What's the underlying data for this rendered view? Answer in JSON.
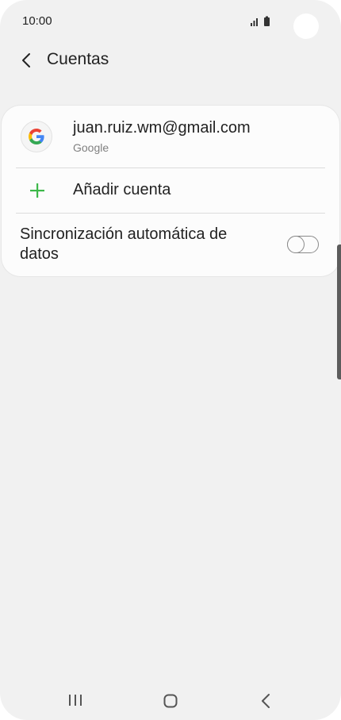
{
  "status_bar": {
    "time": "10:00"
  },
  "header": {
    "title": "Cuentas"
  },
  "accounts": [
    {
      "email": "juan.ruiz.wm@gmail.com",
      "provider": "Google",
      "icon": "google-icon"
    }
  ],
  "add_account": {
    "label": "Añadir cuenta",
    "icon": "plus-icon"
  },
  "auto_sync": {
    "label": "Sincronización automática de datos",
    "enabled": false
  },
  "colors": {
    "background": "#f1f1f1",
    "card": "#fcfcfc",
    "accent_plus": "#3db84a",
    "text_primary": "#222222",
    "text_secondary": "#808080"
  },
  "navigation_bar": {
    "items": [
      "recents-button",
      "home-button",
      "back-button"
    ]
  }
}
